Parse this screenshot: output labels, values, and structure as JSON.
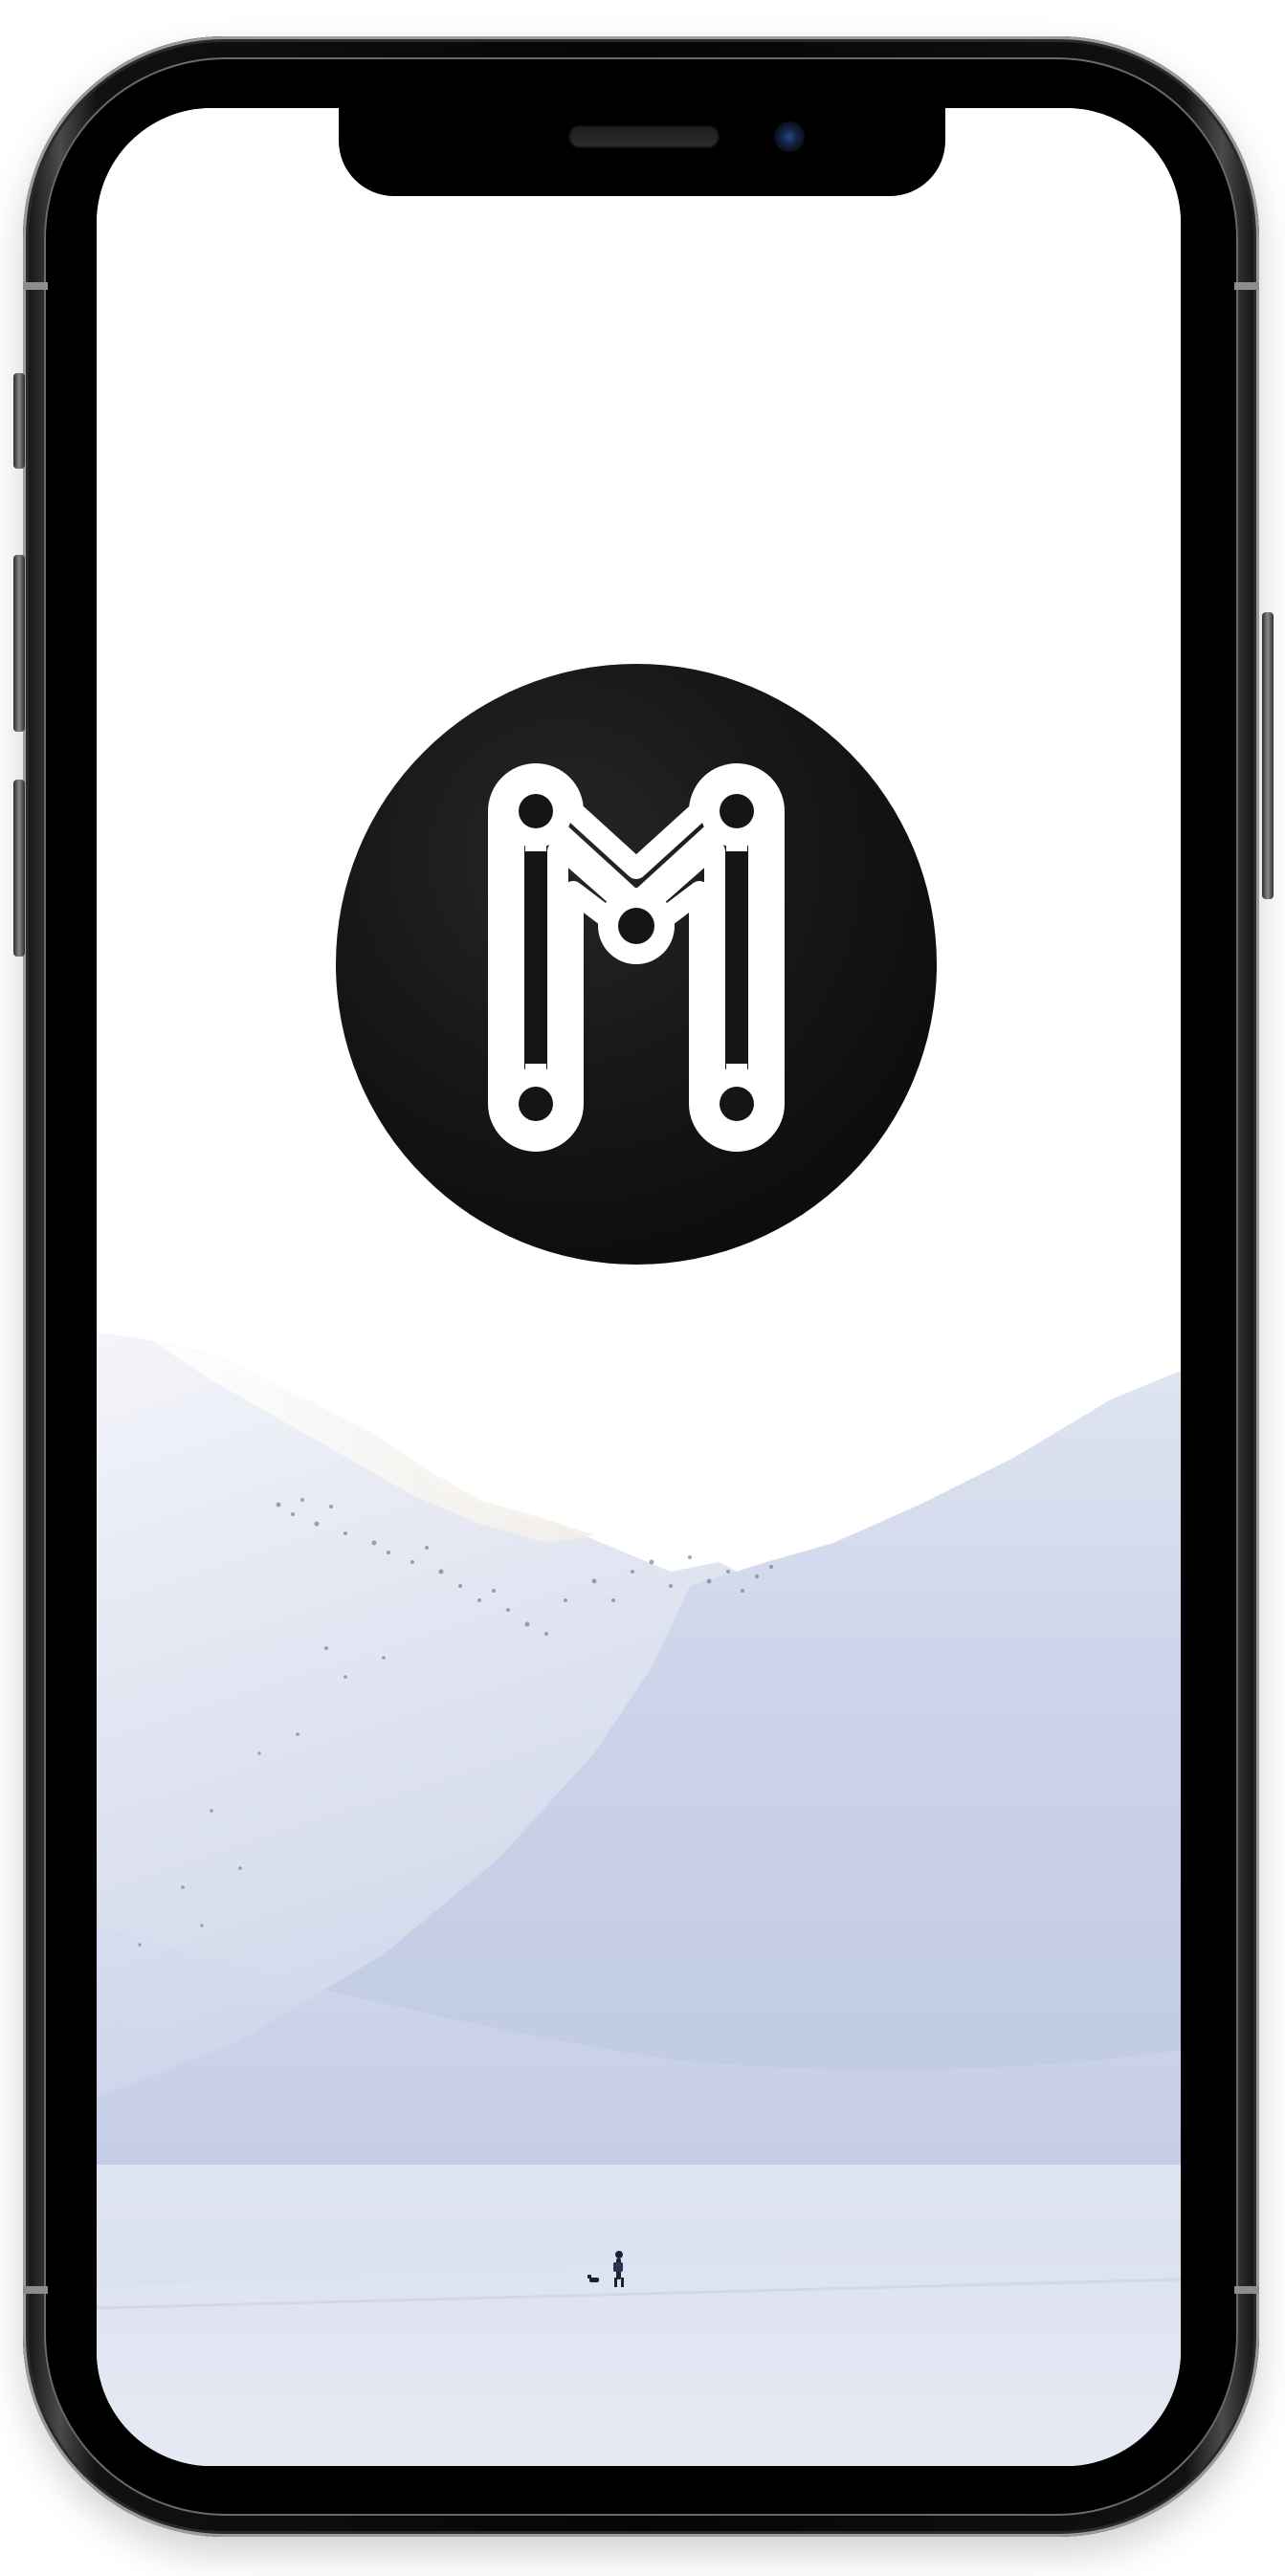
{
  "app": {
    "logo": {
      "icon": "monogram-m-icon",
      "background_color": "#151515",
      "stroke_color": "#ffffff"
    }
  },
  "device": {
    "type": "phone-mockup",
    "frame_color": "#111111",
    "screen_background": "#ffffff"
  },
  "wallpaper": {
    "subject": "snowy-mountains-with-hiker-and-dog",
    "sky_color": "#ffffff",
    "snow_color": "#c9d3ea"
  }
}
